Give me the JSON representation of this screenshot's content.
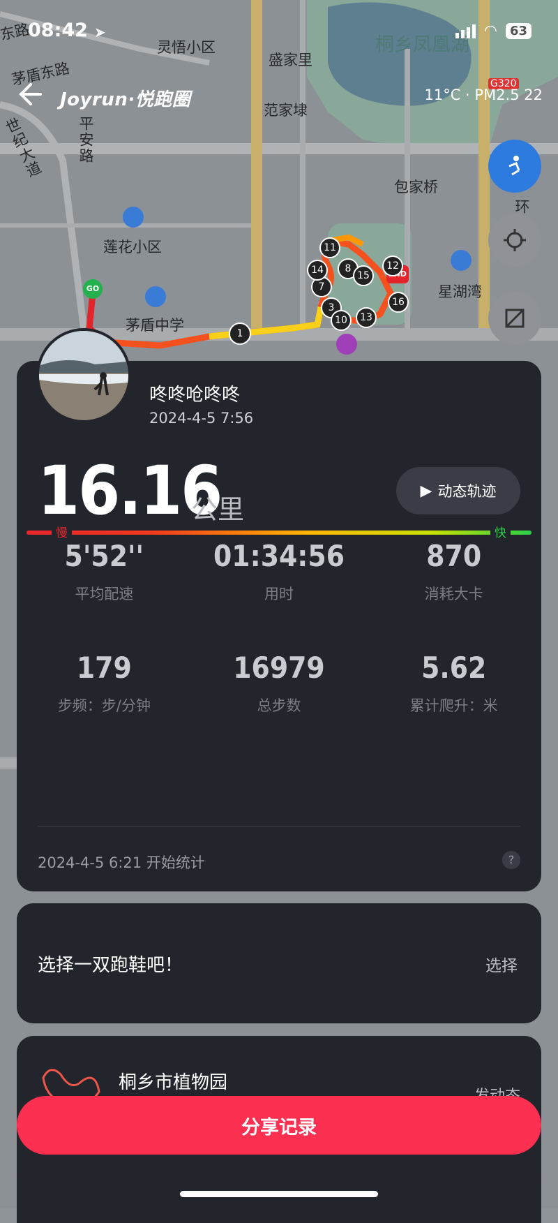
{
  "status_bar": {
    "time": "08:42",
    "battery": "63"
  },
  "header": {
    "app_logo": "Joyrun·悦跑圈",
    "weather": "11°C · PM2.5 22",
    "back_icon": "back-arrow-icon"
  },
  "map": {
    "labels": {
      "lingwu": "灵悟小区",
      "shengjiali": "盛家里",
      "fanjiadai": "范家埭",
      "baojiaqiao": "包家桥",
      "lianhua": "莲花小区",
      "maodun_school": "茅盾中学",
      "xinghu": "星湖湾",
      "lake": "桐乡凤凰湖",
      "maodun_road": "茅盾东路",
      "pingan_road": "平安路",
      "shiji_road": "世纪大道",
      "huandong_road": "环东路",
      "east_road": "东路",
      "road_g320": "G320"
    },
    "route_markers": {
      "go": "GO",
      "end": "END",
      "km": [
        "1",
        "3",
        "7",
        "8",
        "10",
        "11",
        "12",
        "13",
        "14",
        "15",
        "16"
      ]
    }
  },
  "map_controls": {
    "nav_icon": "cyclist-icon",
    "locate_icon": "locate-icon",
    "layer_icon": "map-layer-icon"
  },
  "run": {
    "user_name": "咚咚呛咚咚",
    "date": "2024-4-5 7:56",
    "distance": "16.16",
    "distance_unit": "公里",
    "track_button": "动态轨迹",
    "pace_slow": "慢",
    "pace_fast": "快",
    "stats": [
      {
        "value": "5'52''",
        "label": "平均配速"
      },
      {
        "value": "01:34:56",
        "label": "用时"
      },
      {
        "value": "870",
        "label": "消耗大卡"
      },
      {
        "value": "179",
        "label": "步频：步/分钟"
      },
      {
        "value": "16979",
        "label": "总步数"
      },
      {
        "value": "5.62",
        "label": "累计爬升：米"
      }
    ],
    "start_note": "2024-4-5 6:21 开始统计",
    "help": "?"
  },
  "shoe": {
    "prompt": "选择一双跑鞋吧！",
    "select": "选择"
  },
  "place": {
    "name": "桐乡市植物园",
    "right_text": "发动态"
  },
  "share_button": "分享记录",
  "colors": {
    "card_bg": "#23252d",
    "share": "#fb2f4f",
    "pace_slow": "#e8262b",
    "pace_fast": "#2ad04a"
  }
}
